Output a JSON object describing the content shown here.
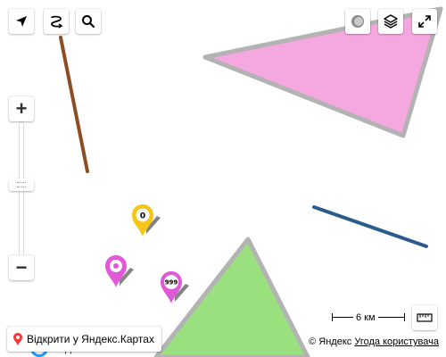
{
  "controls": {
    "geolocation_icon": "arrow-icon",
    "route_icon": "route-icon",
    "search_icon": "search-icon",
    "traffic_icon": "traffic-icon",
    "layers_icon": "layers-icon",
    "fullscreen_icon": "fullscreen-icon",
    "zoom_in_label": "+",
    "zoom_out_label": "−",
    "ruler_icon": "ruler-icon"
  },
  "markers": [
    {
      "label": "0",
      "color": "#f5c518"
    },
    {
      "label": "",
      "color": "#e05ad8"
    },
    {
      "label": "999",
      "color": "#e05ad8"
    }
  ],
  "overlays": {
    "pink_polygon_fill": "#f5a8e0",
    "green_polygon_fill": "#9be07f",
    "polygon_stroke": "#b3b3b3",
    "brown_line": "#8b4f23",
    "blue_line": "#2a5b8c"
  },
  "open_in_maps": {
    "label": "Відкрити у Яндекс.Картах"
  },
  "partial_label": "Подніссь",
  "scale": {
    "label": "6 км"
  },
  "copyright": {
    "text": "© Яндекс",
    "link": "Угода користувача"
  }
}
